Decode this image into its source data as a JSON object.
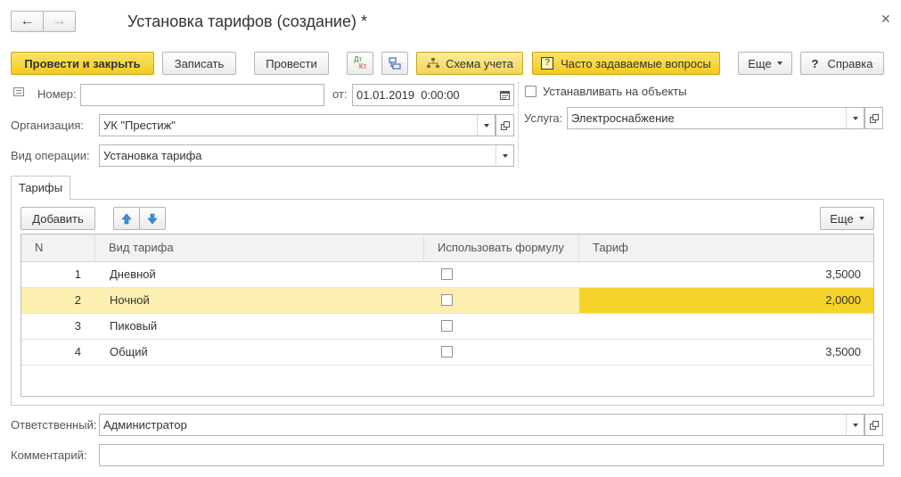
{
  "window": {
    "title": "Установка тарифов (создание) *"
  },
  "toolbar": {
    "post_close": "Провести и закрыть",
    "save": "Записать",
    "post": "Провести",
    "dtkt_top": "Дт",
    "dtkt_bottom": "Кт",
    "scheme": "Схема учета",
    "faq": "Часто задаваемые вопросы",
    "more": "Еще",
    "help": "Справка"
  },
  "form": {
    "number_label": "Номер:",
    "number_value": "",
    "date_label": "от:",
    "date_value": "01.01.2019  0:00:00",
    "org_label": "Организация:",
    "org_value": "УК \"Престиж\"",
    "op_label": "Вид операции:",
    "op_value": "Установка тарифа",
    "set_on_objects_label": "Устанавливать на объекты",
    "service_label": "Услуга:",
    "service_value": "Электроснабжение",
    "responsible_label": "Ответственный:",
    "responsible_value": "Администратор",
    "comment_label": "Комментарий:",
    "comment_value": ""
  },
  "tabs": {
    "tariffs": "Тарифы"
  },
  "table_toolbar": {
    "add": "Добавить",
    "more": "Еще"
  },
  "table": {
    "headers": {
      "n": "N",
      "kind": "Вид тарифа",
      "formula": "Использовать формулу",
      "tariff": "Тариф"
    },
    "rows": [
      {
        "n": "1",
        "kind": "Дневной",
        "formula": false,
        "tariff": "3,5000"
      },
      {
        "n": "2",
        "kind": "Ночной",
        "formula": false,
        "tariff": "2,0000"
      },
      {
        "n": "3",
        "kind": "Пиковый",
        "formula": false,
        "tariff": ""
      },
      {
        "n": "4",
        "kind": "Общий",
        "formula": false,
        "tariff": "3,5000"
      }
    ],
    "selected_row": 2
  },
  "colors": {
    "accent_yellow": "#f5d328",
    "selected_row": "#fbf0b0",
    "arrow_blue": "#3b8fd9"
  }
}
